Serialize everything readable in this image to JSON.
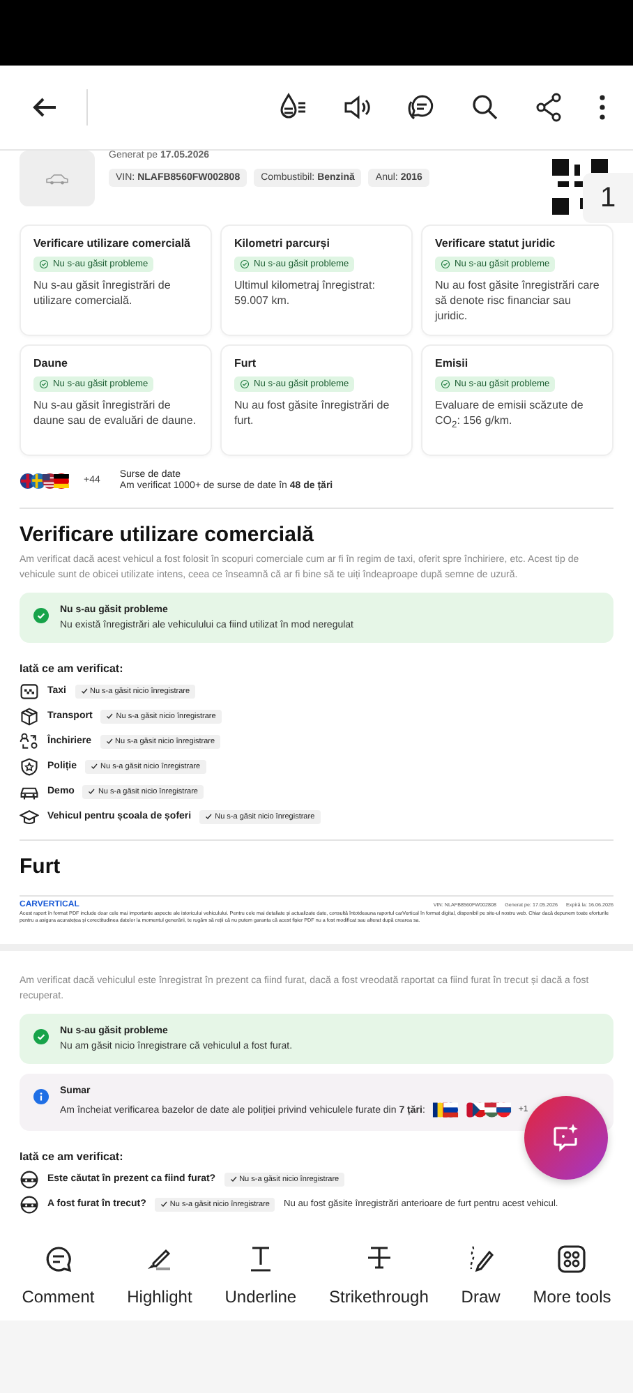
{
  "header": {
    "generated": "Generat pe **17.05.2026**",
    "chips": [
      "VIN: **NLAFB8560FW002808**",
      "Combustibil: **Benzină**",
      "Anul: **2016**"
    ],
    "page_number": "1"
  },
  "cards": [
    {
      "title": "Verificare utilizare comercială",
      "badge": "Nu s-au găsit probleme",
      "text": "Nu s-au găsit înregistrări de utilizare comercială."
    },
    {
      "title": "Kilometri parcurși",
      "badge": "Nu s-au găsit probleme",
      "text": "Ultimul kilometraj înregistrat: 59.007 km."
    },
    {
      "title": "Verificare statut juridic",
      "badge": "Nu s-au găsit probleme",
      "text": "Nu au fost găsite înregistrări care să denote risc financiar sau juridic."
    },
    {
      "title": "Daune",
      "badge": "Nu s-au găsit probleme",
      "text": "Nu s-au găsit înregistrări de daune sau de evaluări de daune."
    },
    {
      "title": "Furt",
      "badge": "Nu s-au găsit probleme",
      "text": "Nu au fost găsite înregistrări de furt."
    },
    {
      "title": "Emisii",
      "badge": "Nu s-au găsit probleme",
      "text": "Evaluare de emisii scăzute de CO$_{2}$: 156 g/km."
    }
  ],
  "sources": {
    "count": "+44",
    "title": "Surse de date",
    "text": "Am verificat 1000+ de surse de date în **48 de țări**"
  },
  "commercial": {
    "title": "Verificare utilizare comercială",
    "description": "Am verificat dacă acest vehicul a fost folosit în scopuri comerciale cum ar fi în regim de taxi, oferit spre închiriere, etc. Acest tip de vehicule sunt de obicei utilizate intens, ceea ce înseamnă că ar fi bine să te uiți îndeaproape după semne de uzură.",
    "result": {
      "title": "Nu s-au găsit probleme",
      "text": "Nu există înregistrări ale vehiculului ca fiind utilizat în mod neregulat"
    },
    "checked_heading": "Iată ce am verificat:",
    "checks": [
      {
        "label": "Taxi",
        "status": "Nu s-a găsit nicio înregistrare"
      },
      {
        "label": "Transport",
        "status": "Nu s-a găsit nicio înregistrare"
      },
      {
        "label": "Închiriere",
        "status": "Nu s-a găsit nicio înregistrare"
      },
      {
        "label": "Poliție",
        "status": "Nu s-a găsit nicio înregistrare"
      },
      {
        "label": "Demo",
        "status": "Nu s-a găsit nicio înregistrare"
      },
      {
        "label": "Vehicul pentru școala de șoferi",
        "status": "Nu s-a găsit nicio înregistrare"
      }
    ]
  },
  "theft": {
    "title": "Furt",
    "pdf_footer": {
      "brand": "CARVERTICAL",
      "meta": [
        "VIN: NLAFB8560FW002808",
        "Generat pe: 17.05.2026",
        "Expiră la: 16.06.2026"
      ],
      "text": "Acest raport în format PDF include doar cele mai importante aspecte ale istoricului vehiculului. Pentru cele mai detaliate și actualizate date, consultă întotdeauna raportul carVertical în format digital, disponibil pe site-ul nostru web. Chiar dacă depunem toate eforturile pentru a asigura acuratețea și corectitudinea datelor la momentul generării, te rugăm să reții că nu putem garanta că acest fișier PDF nu a fost modificat sau alterat după crearea sa."
    },
    "description": "Am verificat dacă vehiculul este înregistrat în prezent ca fiind furat, dacă a fost vreodată raportat ca fiind furat în trecut și dacă a fost recuperat.",
    "result": {
      "title": "Nu s-au găsit probleme",
      "text": "Nu am găsit nicio înregistrare că vehiculul a fost furat."
    },
    "summary": {
      "title": "Sumar",
      "text": "Am încheiat verificarea bazelor de date ale poliției privind vehiculele furate din **7 țări**:",
      "more": "+1"
    },
    "checked_heading": "Iată ce am verificat:",
    "checks": [
      {
        "label": "Este căutat în prezent ca fiind furat?",
        "status": "Nu s-a găsit nicio înregistrare"
      },
      {
        "label": "A fost furat în trecut?",
        "status": "Nu s-a găsit nicio înregistrare",
        "note": "Nu au fost găsite înregistrări anterioare de furt pentru acest vehicul."
      }
    ]
  },
  "tools": [
    {
      "label": "Comment"
    },
    {
      "label": "Highlight"
    },
    {
      "label": "Underline"
    },
    {
      "label": "Strikethrough"
    },
    {
      "label": "Draw"
    },
    {
      "label": "More tools"
    }
  ]
}
